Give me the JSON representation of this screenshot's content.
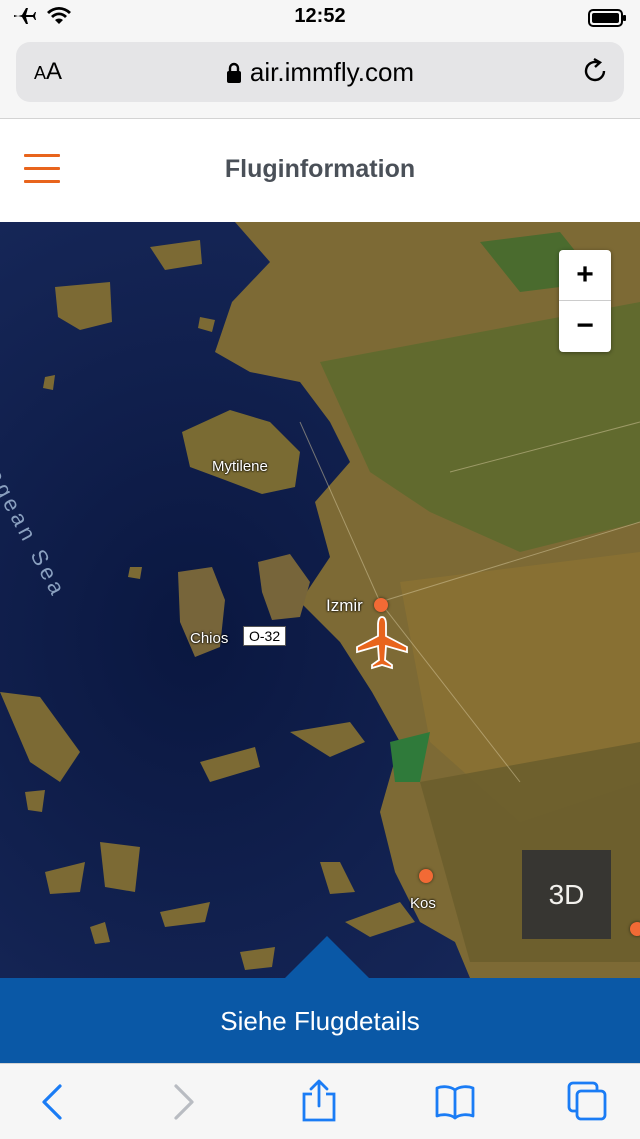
{
  "status_bar": {
    "time": "12:52"
  },
  "browser": {
    "url": "air.immfly.com",
    "text_size_label": "AA"
  },
  "header": {
    "title": "Fluginformation"
  },
  "map": {
    "sea_label": "Aegean Sea",
    "places": {
      "mytilene": "Mytilene",
      "izmir": "Izmir",
      "chios": "Chios",
      "kos": "Kos"
    },
    "route_badge": "O-32",
    "zoom_in_label": "+",
    "zoom_out_label": "−",
    "view_3d_label": "3D"
  },
  "details_bar": {
    "label": "Siehe Flugdetails"
  },
  "colors": {
    "accent": "#e8641c",
    "primary_blue": "#0a58a6",
    "safari_blue": "#1a7cf5"
  },
  "icons": [
    "airplane-mode-icon",
    "wifi-icon",
    "battery-icon",
    "lock-icon",
    "reload-icon",
    "menu-icon",
    "plane-icon",
    "back-icon",
    "forward-icon",
    "share-icon",
    "bookmarks-icon",
    "tabs-icon"
  ]
}
